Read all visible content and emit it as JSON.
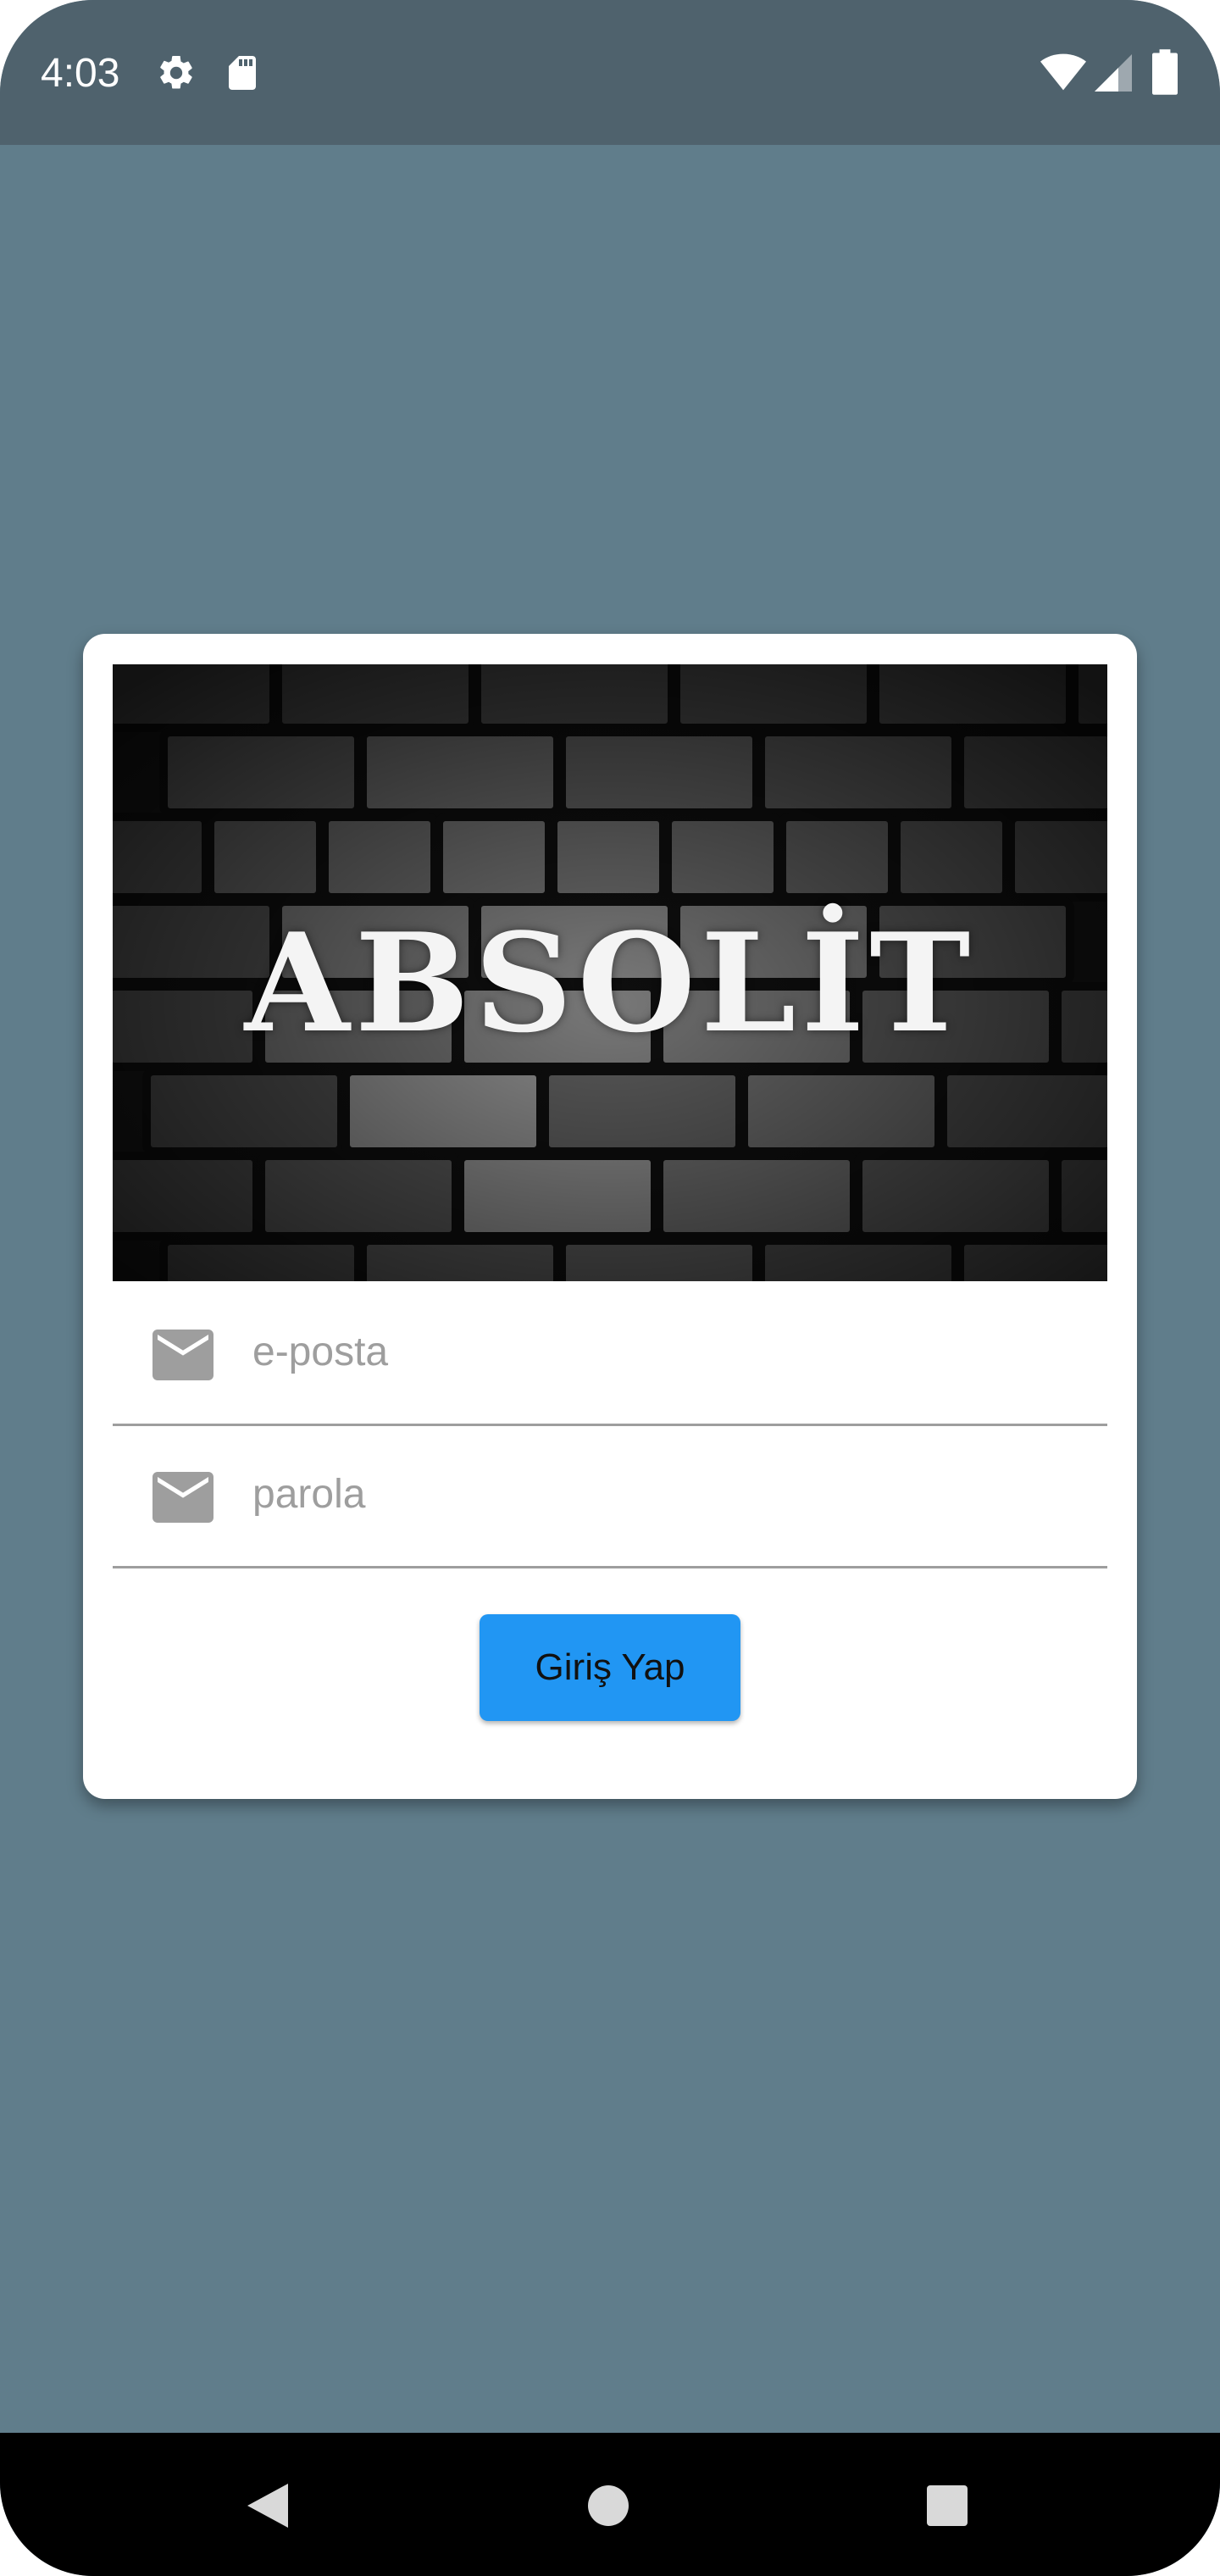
{
  "status_bar": {
    "time": "4:03",
    "left_icons": [
      "gear-icon",
      "sd-card-icon"
    ],
    "right_icons": [
      "wifi-icon",
      "signal-icon",
      "battery-icon"
    ]
  },
  "hero": {
    "brand": "ABSOLİT"
  },
  "login_form": {
    "email_placeholder": "e-posta",
    "password_placeholder": "parola",
    "submit_label": "Giriş Yap"
  },
  "nav_bar": {
    "buttons": [
      "back-icon",
      "home-icon",
      "recents-icon"
    ]
  },
  "colors": {
    "background": "#607d8b",
    "status_bar": "#4f626d",
    "button": "#2196f3",
    "icon_gray": "#9e9e9e"
  }
}
